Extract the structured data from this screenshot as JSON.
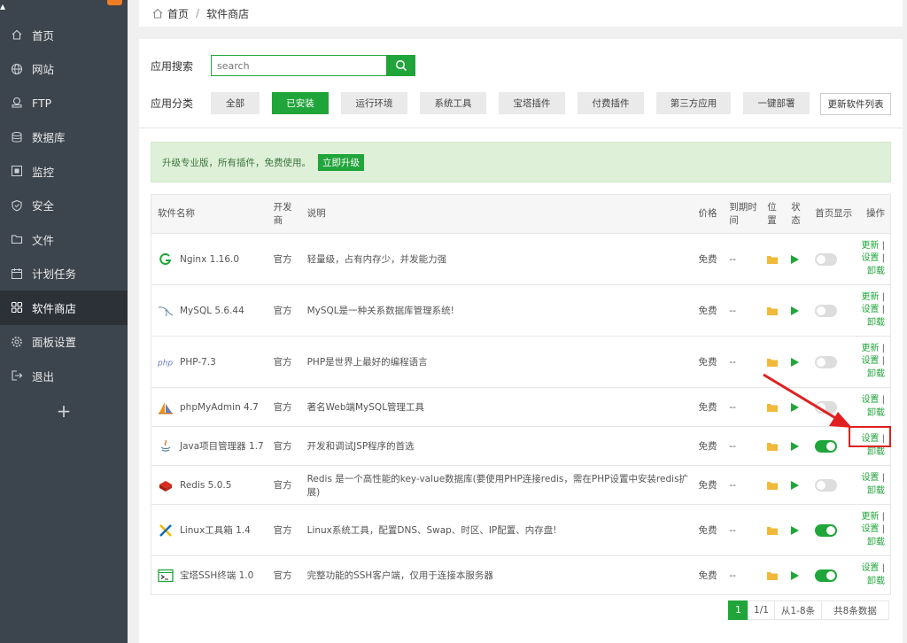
{
  "sidebar": {
    "items": [
      {
        "label": "首页",
        "icon": "home-icon"
      },
      {
        "label": "网站",
        "icon": "globe-icon"
      },
      {
        "label": "FTP",
        "icon": "ftp-icon"
      },
      {
        "label": "数据库",
        "icon": "database-icon"
      },
      {
        "label": "监控",
        "icon": "monitor-icon"
      },
      {
        "label": "安全",
        "icon": "shield-icon"
      },
      {
        "label": "文件",
        "icon": "folder-icon"
      },
      {
        "label": "计划任务",
        "icon": "calendar-icon"
      },
      {
        "label": "软件商店",
        "icon": "apps-icon",
        "active": true
      },
      {
        "label": "面板设置",
        "icon": "gear-icon"
      },
      {
        "label": "退出",
        "icon": "logout-icon"
      }
    ],
    "add_label": "+"
  },
  "breadcrumb": {
    "home": "首页",
    "sep": "/",
    "current": "软件商店"
  },
  "search": {
    "label": "应用搜索",
    "placeholder": "search"
  },
  "category": {
    "label": "应用分类",
    "items": [
      "全部",
      "已安装",
      "运行环境",
      "系统工具",
      "宝塔插件",
      "付费插件",
      "第三方应用",
      "一键部署"
    ],
    "active_index": 1,
    "refresh_label": "更新软件列表"
  },
  "promo": {
    "text": "升级专业版，所有插件，免费使用。",
    "button": "立即升级"
  },
  "table": {
    "headers": {
      "name": "软件名称",
      "dev": "开发商",
      "desc": "说明",
      "price": "价格",
      "expire": "到期时间",
      "location": "位置",
      "status": "状态",
      "homepage": "首页显示",
      "ops": "操作"
    },
    "rows": [
      {
        "name": "Nginx 1.16.0",
        "icon": "nginx-icon",
        "dev": "官方",
        "desc": "轻量级，占有内存少，并发能力强",
        "price": "免费",
        "expire": "--",
        "show": false,
        "ops": [
          "更新",
          "设置",
          "卸载"
        ]
      },
      {
        "name": "MySQL 5.6.44",
        "icon": "mysql-icon",
        "dev": "官方",
        "desc": "MySQL是一种关系数据库管理系统!",
        "price": "免费",
        "expire": "--",
        "show": false,
        "ops": [
          "更新",
          "设置",
          "卸载"
        ]
      },
      {
        "name": "PHP-7.3",
        "icon": "php-icon",
        "dev": "官方",
        "desc": "PHP是世界上最好的编程语言",
        "price": "免费",
        "expire": "--",
        "show": false,
        "ops": [
          "更新",
          "设置",
          "卸载"
        ]
      },
      {
        "name": "phpMyAdmin 4.7",
        "icon": "phpmyadmin-icon",
        "dev": "官方",
        "desc": "著名Web端MySQL管理工具",
        "price": "免费",
        "expire": "--",
        "show": false,
        "ops": [
          "设置",
          "卸载"
        ]
      },
      {
        "name": "Java项目管理器 1.7",
        "icon": "java-icon",
        "dev": "官方",
        "desc": "开发和调试JSP程序的首选",
        "price": "免费",
        "expire": "--",
        "show": true,
        "ops": [
          "设置",
          "卸载"
        ]
      },
      {
        "name": "Redis 5.0.5",
        "icon": "redis-icon",
        "dev": "官方",
        "desc": "Redis 是一个高性能的key-value数据库(要使用PHP连接redis，需在PHP设置中安装redis扩展)",
        "price": "免费",
        "expire": "--",
        "show": false,
        "ops": [
          "设置",
          "卸载"
        ]
      },
      {
        "name": "Linux工具箱 1.4",
        "icon": "tools-icon",
        "dev": "官方",
        "desc": "Linux系统工具，配置DNS、Swap、时区、IP配置、内存盘!",
        "price": "免费",
        "expire": "--",
        "show": true,
        "ops": [
          "更新",
          "设置",
          "卸载"
        ]
      },
      {
        "name": "宝塔SSH终端 1.0",
        "icon": "terminal-icon",
        "dev": "官方",
        "desc": "完整功能的SSH客户端，仅用于连接本服务器",
        "price": "免费",
        "expire": "--",
        "show": true,
        "ops": [
          "设置",
          "卸载"
        ]
      }
    ]
  },
  "pagination": {
    "current": "1",
    "pages": "1/1",
    "range": "从1-8条",
    "total": "共8条数据"
  },
  "colors": {
    "accent": "#20a53a",
    "sidebar": "#3c444d",
    "annotation": "#e02020"
  }
}
